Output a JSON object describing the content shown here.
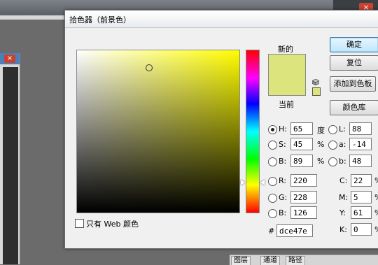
{
  "dialog": {
    "title": "拾色器（前景色）",
    "label_new": "新的",
    "label_current": "当前",
    "new_color": "#dce47e",
    "current_color": "#dce47e",
    "field_hue_color": "#fffd00"
  },
  "buttons": {
    "ok": "确定",
    "reset": "复位",
    "add_to_swatches": "添加到色板",
    "color_libraries": "颜色库"
  },
  "hsb": {
    "h": {
      "label": "H:",
      "value": "65",
      "unit": "度",
      "selected": true
    },
    "s": {
      "label": "S:",
      "value": "45",
      "unit": "%"
    },
    "b": {
      "label": "B:",
      "value": "89",
      "unit": "%"
    }
  },
  "rgb": {
    "r": {
      "label": "R:",
      "value": "220"
    },
    "g": {
      "label": "G:",
      "value": "228"
    },
    "b": {
      "label": "B:",
      "value": "126"
    }
  },
  "lab": {
    "l": {
      "label": "L:",
      "value": "88"
    },
    "a": {
      "label": "a:",
      "value": "-14"
    },
    "b": {
      "label": "b:",
      "value": "48"
    }
  },
  "cmyk": {
    "c": {
      "label": "C:",
      "value": "22",
      "unit": "%"
    },
    "m": {
      "label": "M:",
      "value": "5",
      "unit": "%"
    },
    "y": {
      "label": "Y:",
      "value": "61",
      "unit": "%"
    },
    "k": {
      "label": "K:",
      "value": "0",
      "unit": "%"
    }
  },
  "hex": {
    "label": "#",
    "value": "dce47e"
  },
  "web_only": {
    "label": "只有 Web 颜色",
    "checked": false
  },
  "background": {
    "tabs": [
      "图层",
      "通道",
      "路径"
    ],
    "close_glyph": "×"
  }
}
